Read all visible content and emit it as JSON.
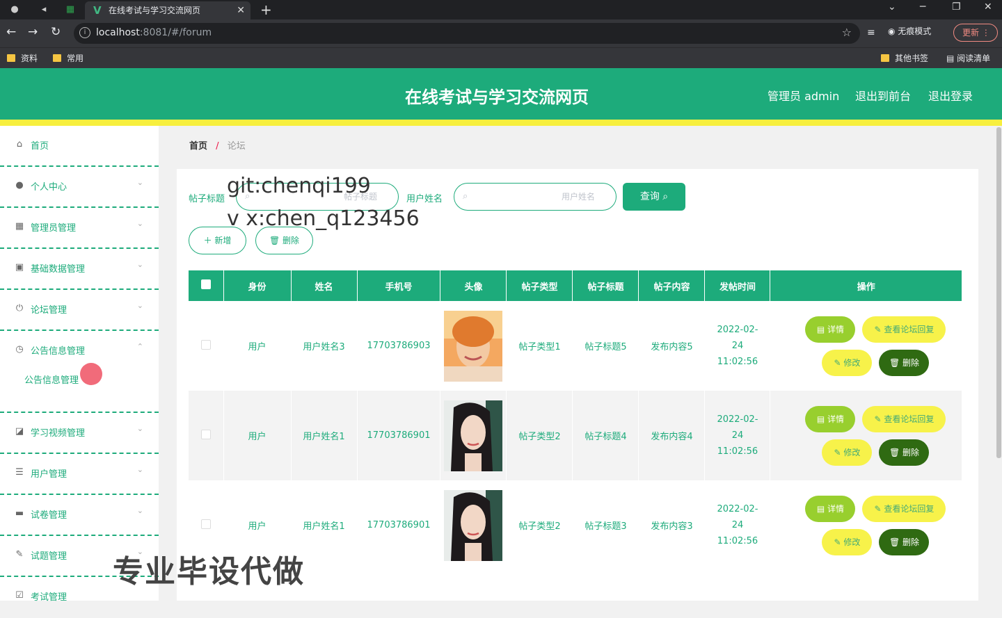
{
  "browser": {
    "tab_title": "在线考试与学习交流网页",
    "url_host": "localhost",
    "url_rest": ":8081/#/forum",
    "incognito_label": "无痕模式",
    "update_label": "更新",
    "bookmarks": [
      "资料",
      "常用"
    ],
    "bookmarks_right": [
      "其他书签",
      "阅读清单"
    ]
  },
  "header": {
    "title": "在线考试与学习交流网页",
    "admin_label": "管理员 admin",
    "to_front": "退出到前台",
    "logout": "退出登录"
  },
  "sidebar": {
    "items": [
      {
        "label": "首页",
        "icon": "home-icon"
      },
      {
        "label": "个人中心",
        "icon": "user-icon"
      },
      {
        "label": "管理员管理",
        "icon": "grid-icon"
      },
      {
        "label": "基础数据管理",
        "icon": "clipboard-icon"
      },
      {
        "label": "论坛管理",
        "icon": "power-icon"
      },
      {
        "label": "公告信息管理",
        "icon": "clock-icon"
      },
      {
        "label": "学习视频管理",
        "icon": "chart-icon"
      },
      {
        "label": "用户管理",
        "icon": "list-icon"
      },
      {
        "label": "试卷管理",
        "icon": "message-icon"
      },
      {
        "label": "试题管理",
        "icon": "edit-icon"
      },
      {
        "label": "考试管理",
        "icon": "check-icon"
      }
    ],
    "submenu": "公告信息管理"
  },
  "breadcrumb": {
    "home": "首页",
    "sep": "/",
    "current": "论坛"
  },
  "search": {
    "title_label": "帖子标题",
    "title_placeholder": "帖子标题",
    "name_label": "用户姓名",
    "name_placeholder": "用户姓名",
    "query_label": "查询 ⌕"
  },
  "actions": {
    "add": "＋ 新增",
    "delete": "🗑 删除"
  },
  "watermarks": [
    "git:chenqi199",
    "v x:chen_q123456",
    "专业毕设代做"
  ],
  "table": {
    "headers": [
      "身份",
      "姓名",
      "手机号",
      "头像",
      "帖子类型",
      "帖子标题",
      "帖子内容",
      "发帖时间",
      "操作"
    ],
    "rows": [
      {
        "role": "用户",
        "name": "用户姓名3",
        "phone": "17703786903",
        "type": "帖子类型1",
        "title": "帖子标题5",
        "content": "发布内容5",
        "time": "2022-02-24 11:02:56"
      },
      {
        "role": "用户",
        "name": "用户姓名1",
        "phone": "17703786901",
        "type": "帖子类型2",
        "title": "帖子标题4",
        "content": "发布内容4",
        "time": "2022-02-24 11:02:56"
      },
      {
        "role": "用户",
        "name": "用户姓名1",
        "phone": "17703786901",
        "type": "帖子类型2",
        "title": "帖子标题3",
        "content": "发布内容3",
        "time": "2022-02-24 11:02:56"
      }
    ],
    "ops": {
      "detail": "▤ 详情",
      "reply": "✎ 查看论坛回复",
      "edit": "✎ 修改",
      "delete": "🗑 删除"
    }
  },
  "colors": {
    "primary": "#1dab7b",
    "accent_yellow": "#f7ef3e",
    "lime": "#98cf2e",
    "dark_green": "#2f6a12"
  }
}
